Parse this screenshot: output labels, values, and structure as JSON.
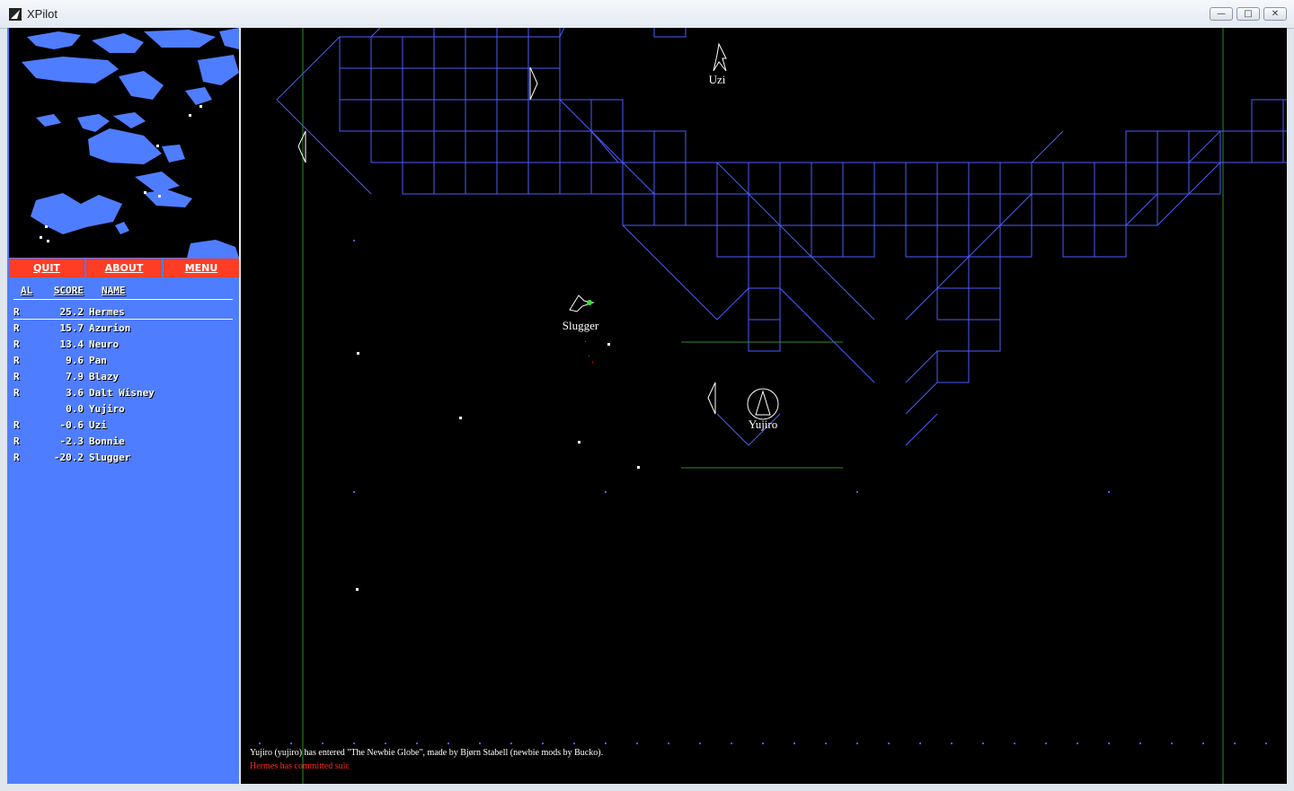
{
  "window": {
    "title": "XPilot",
    "buttons": [
      "minimize",
      "maximize",
      "close"
    ]
  },
  "menu": {
    "quit_label": "QUIT",
    "about_label": "ABOUT",
    "menu_label": "MENU"
  },
  "scoreboard": {
    "headers": {
      "al": "AL",
      "score": "SCORE",
      "name": "NAME"
    },
    "rows": [
      {
        "al": "R",
        "score": "25.2",
        "name": "Hermes"
      },
      {
        "al": "R",
        "score": "15.7",
        "name": "Azurion"
      },
      {
        "al": "R",
        "score": "13.4",
        "name": "Neuro"
      },
      {
        "al": "R",
        "score": "9.6",
        "name": "Pan"
      },
      {
        "al": "R",
        "score": "7.9",
        "name": "Blazy"
      },
      {
        "al": "R",
        "score": "3.6",
        "name": "Dalt Wisney"
      },
      {
        "al": "",
        "score": "0.0",
        "name": "Yujiro"
      },
      {
        "al": "R",
        "score": "-0.6",
        "name": "Uzi"
      },
      {
        "al": "R",
        "score": "-2.3",
        "name": "Bonnie"
      },
      {
        "al": "R",
        "score": "-20.2",
        "name": "Slugger"
      }
    ]
  },
  "ships": {
    "uzi": "Uzi",
    "slugger": "Slugger",
    "yujiro": "Yujiro"
  },
  "messages": [
    {
      "text": "Yujiro (yujiro) has entered \"The Newbie Globe\", made by Bjørn Stabell (newbie mods by Bucko).",
      "color": "#ffffff"
    },
    {
      "text": "Hermes has committed suic",
      "color": "#ff2a1a"
    }
  ],
  "colors": {
    "wall": "#4b5cff",
    "sidebar": "#4f7dff",
    "button": "#ff3d24",
    "boundary": "#2e8b2e"
  }
}
